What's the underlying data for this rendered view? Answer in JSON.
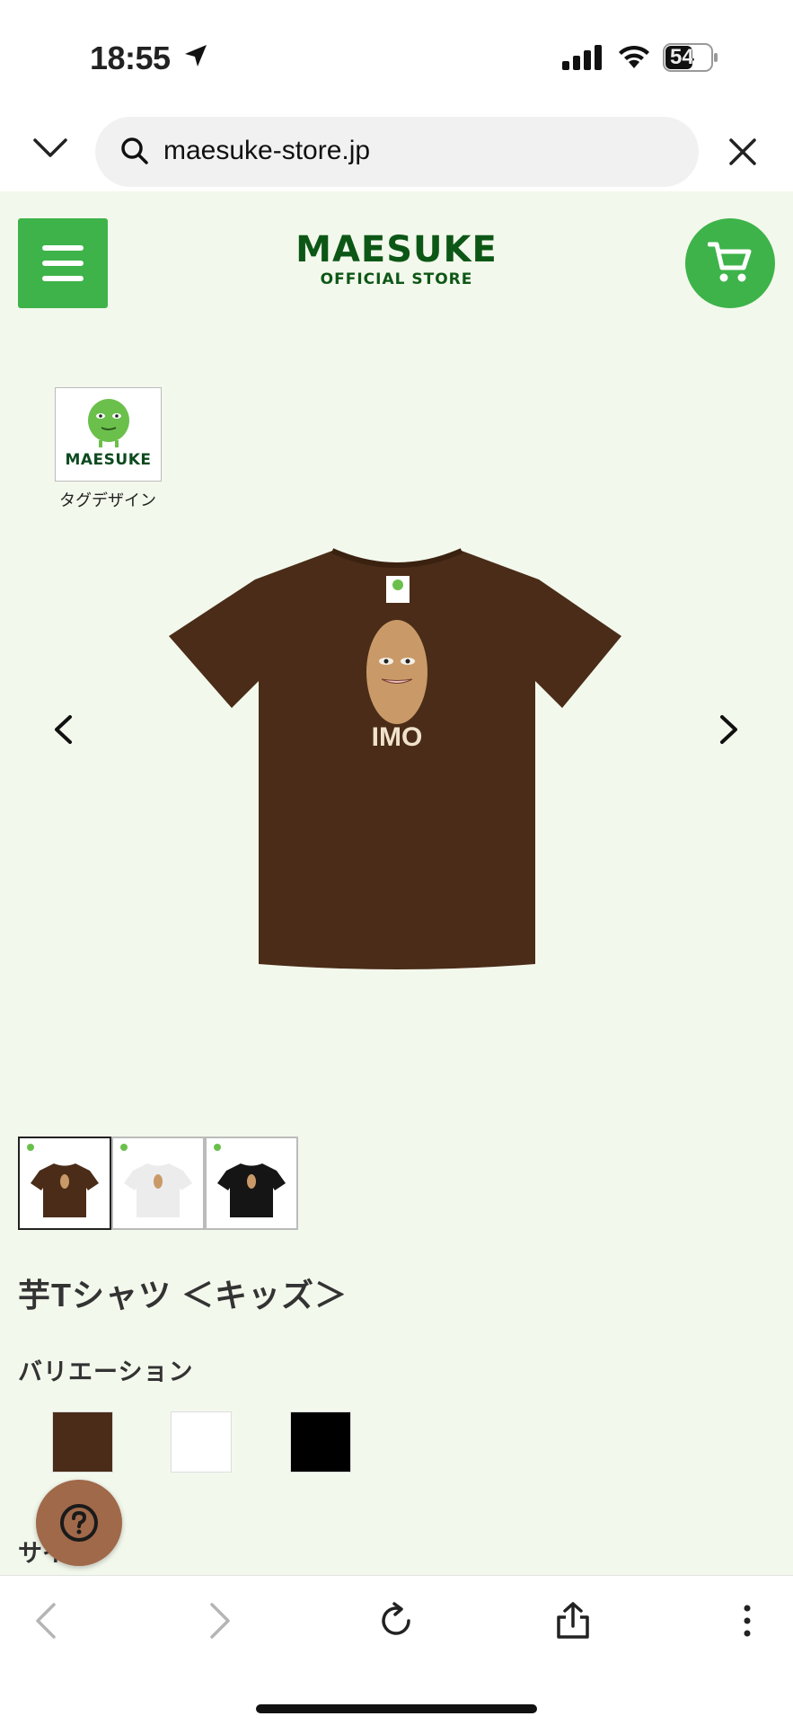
{
  "status_bar": {
    "time": "18:55",
    "battery": "54"
  },
  "url_bar": {
    "url": "maesuke-store.jp"
  },
  "header": {
    "logo_main": "MAESUKE",
    "logo_sub": "OFFICIAL STORE"
  },
  "tag": {
    "card_text": "MAESUKE",
    "label": "タグデザイン"
  },
  "main_image": {
    "print_text": "IMO",
    "tshirt_color": "#4a2c18"
  },
  "thumbnails": [
    {
      "color": "#4a2c18",
      "active": true
    },
    {
      "color": "#ececec",
      "active": false
    },
    {
      "color": "#151515",
      "active": false
    }
  ],
  "product": {
    "title": "芋Tシャツ ＜キッズ＞",
    "variation_label": "バリエーション",
    "variations": [
      "#4a2c18",
      "#ffffff",
      "#000000"
    ],
    "size_label": "サイズ"
  },
  "colors": {
    "brand_green": "#3db34a",
    "logo_dark_green": "#0d5716",
    "page_bg": "#f3f8ec",
    "help_button": "#a0694a"
  }
}
